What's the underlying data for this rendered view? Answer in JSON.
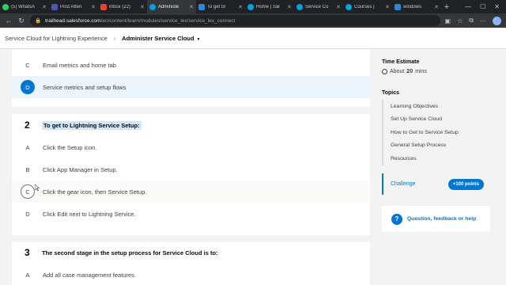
{
  "browser": {
    "tabs": [
      {
        "title": "(5) WhatsA",
        "color": "#25d366",
        "active": false
      },
      {
        "title": "Post Atten",
        "color": "#4b53bc",
        "active": false
      },
      {
        "title": "Inbox (22)",
        "color": "#ea4335",
        "active": false
      },
      {
        "title": "Administe",
        "color": "#00a1e0",
        "active": true
      },
      {
        "title": "To get to",
        "color": "#2b88d8",
        "active": false
      },
      {
        "title": "Home | Sal",
        "color": "#00a1e0",
        "active": false
      },
      {
        "title": "Service Co",
        "color": "#00a1e0",
        "active": false
      },
      {
        "title": "Courses |",
        "color": "#00a1e0",
        "active": false
      },
      {
        "title": "windows",
        "color": "#2b88d8",
        "active": false
      }
    ],
    "url_host": "trailhead.salesforce.com",
    "url_path": "/en/content/learn/modules/service_lex/service_lex_connect"
  },
  "subheader": {
    "breadcrumb": "Service Cloud for Lightning Experience",
    "current": "Administer Service Cloud"
  },
  "content": {
    "q1_options": [
      {
        "letter": "C",
        "text": "Email metrics and home tab"
      },
      {
        "letter": "D",
        "text": "Service metrics and setup flows"
      }
    ],
    "q2": {
      "number": "2",
      "text": "To get to Lightning Service Setup:",
      "options": [
        {
          "letter": "A",
          "text": "Click the Setup icon."
        },
        {
          "letter": "B",
          "text": "Click App Manager in Setup."
        },
        {
          "letter": "C",
          "text": "Click the gear icon, then Service Setup."
        },
        {
          "letter": "D",
          "text": "Click Edit next to Lightning Service."
        }
      ]
    },
    "q3": {
      "number": "3",
      "text": "The second stage in the setup process for Service Cloud is to:",
      "options": [
        {
          "letter": "A",
          "text": "Add all case management features."
        }
      ]
    }
  },
  "sidebar": {
    "estimate_label": "Time Estimate",
    "estimate_prefix": "About",
    "estimate_value": "20",
    "estimate_unit": "mins",
    "topics_label": "Topics",
    "topics": [
      "Learning Objectives",
      "Set Up Service Cloud",
      "How to Get to Service Setup",
      "General Setup Process",
      "Resources"
    ],
    "challenge_label": "Challenge",
    "points": "+100 points",
    "feedback": "Question, feedback or help"
  }
}
